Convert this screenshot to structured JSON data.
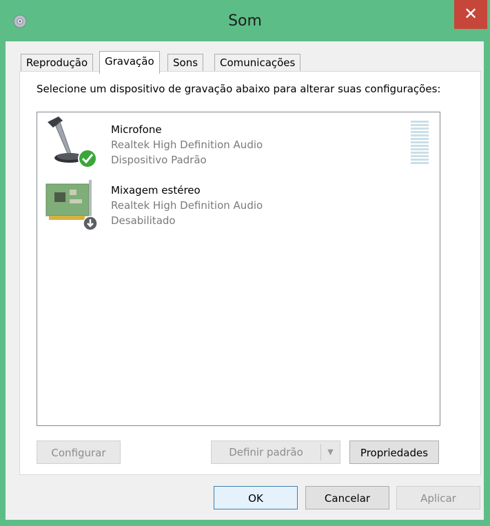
{
  "window": {
    "title": "Som",
    "close_label": "✕"
  },
  "tabs": [
    {
      "label": "Reprodução",
      "active": false
    },
    {
      "label": "Gravação",
      "active": true
    },
    {
      "label": "Sons",
      "active": false
    },
    {
      "label": "Comunicações",
      "active": false
    }
  ],
  "panel": {
    "instructions": "Selecione um dispositivo de gravação abaixo para alterar suas configurações:"
  },
  "devices": [
    {
      "name": "Microfone",
      "driver": "Realtek High Definition Audio",
      "status": "Dispositivo Padrão",
      "icon": "microphone-icon",
      "badge": "default-check-icon"
    },
    {
      "name": "Mixagem estéreo",
      "driver": "Realtek High Definition Audio",
      "status": "Desabilitado",
      "icon": "sound-card-icon",
      "badge": "disabled-arrow-icon"
    }
  ],
  "panel_buttons": {
    "configure": "Configurar",
    "set_default": "Definir padrão",
    "set_default_arrow": "▼",
    "properties": "Propriedades"
  },
  "dialog_buttons": {
    "ok": "OK",
    "cancel": "Cancelar",
    "apply": "Aplicar"
  },
  "colors": {
    "titlebar": "#5dbd87",
    "close": "#c7463a",
    "check": "#3aa63a",
    "meter": "#c9dfe7"
  }
}
